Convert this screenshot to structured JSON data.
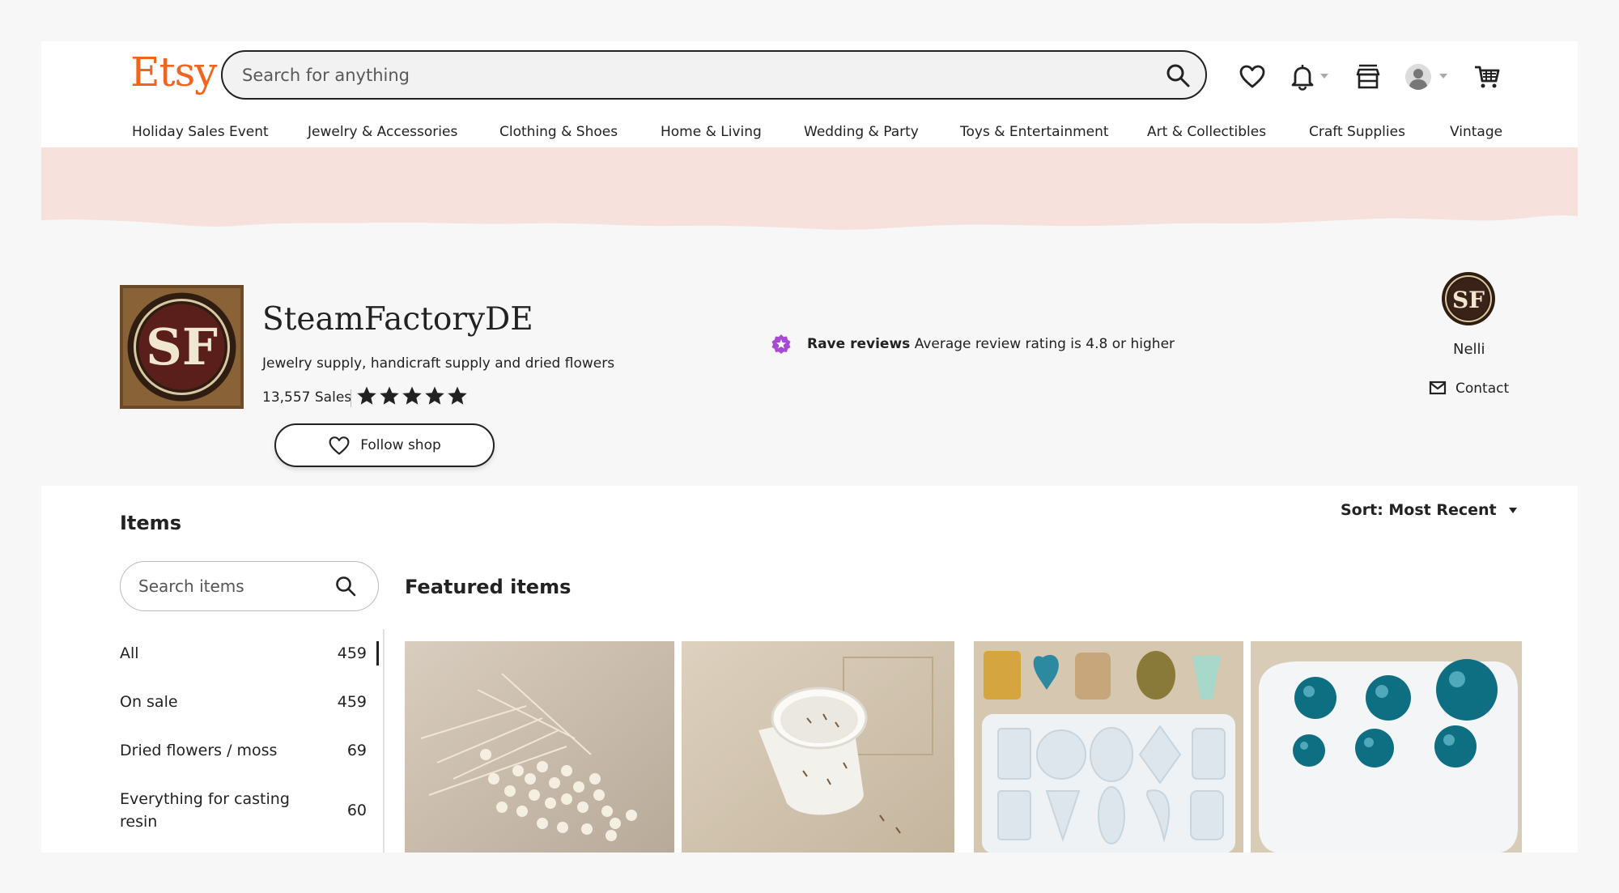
{
  "header": {
    "logo_text": "Etsy",
    "search_placeholder": "Search for anything",
    "nav": [
      "Holiday Sales Event",
      "Jewelry & Accessories",
      "Clothing & Shoes",
      "Home & Living",
      "Wedding & Party",
      "Toys & Entertainment",
      "Art & Collectibles",
      "Craft Supplies",
      "Vintage"
    ]
  },
  "shop": {
    "logo_text": "SF",
    "name": "SteamFactoryDE",
    "tagline": "Jewelry supply, handicraft supply and dried flowers",
    "sales": "13,557 Sales",
    "rating_stars": 5,
    "follow_label": "Follow shop",
    "rave_title": "Rave reviews",
    "rave_text": "Average review rating is 4.8 or higher",
    "owner_name": "Nelli",
    "contact_label": "Contact"
  },
  "items": {
    "title": "Items",
    "search_placeholder": "Search items",
    "categories": [
      {
        "label": "All",
        "count": "459"
      },
      {
        "label": "On sale",
        "count": "459"
      },
      {
        "label": "Dried flowers / moss",
        "count": "69"
      },
      {
        "label": "Everything for casting resin",
        "count": "60"
      }
    ],
    "sort_label": "Sort: Most Recent",
    "featured_title": "Featured items"
  },
  "colors": {
    "brand": "#f1641e",
    "banner": "#f6e1dc",
    "rave_badge": "#a74bd6"
  }
}
